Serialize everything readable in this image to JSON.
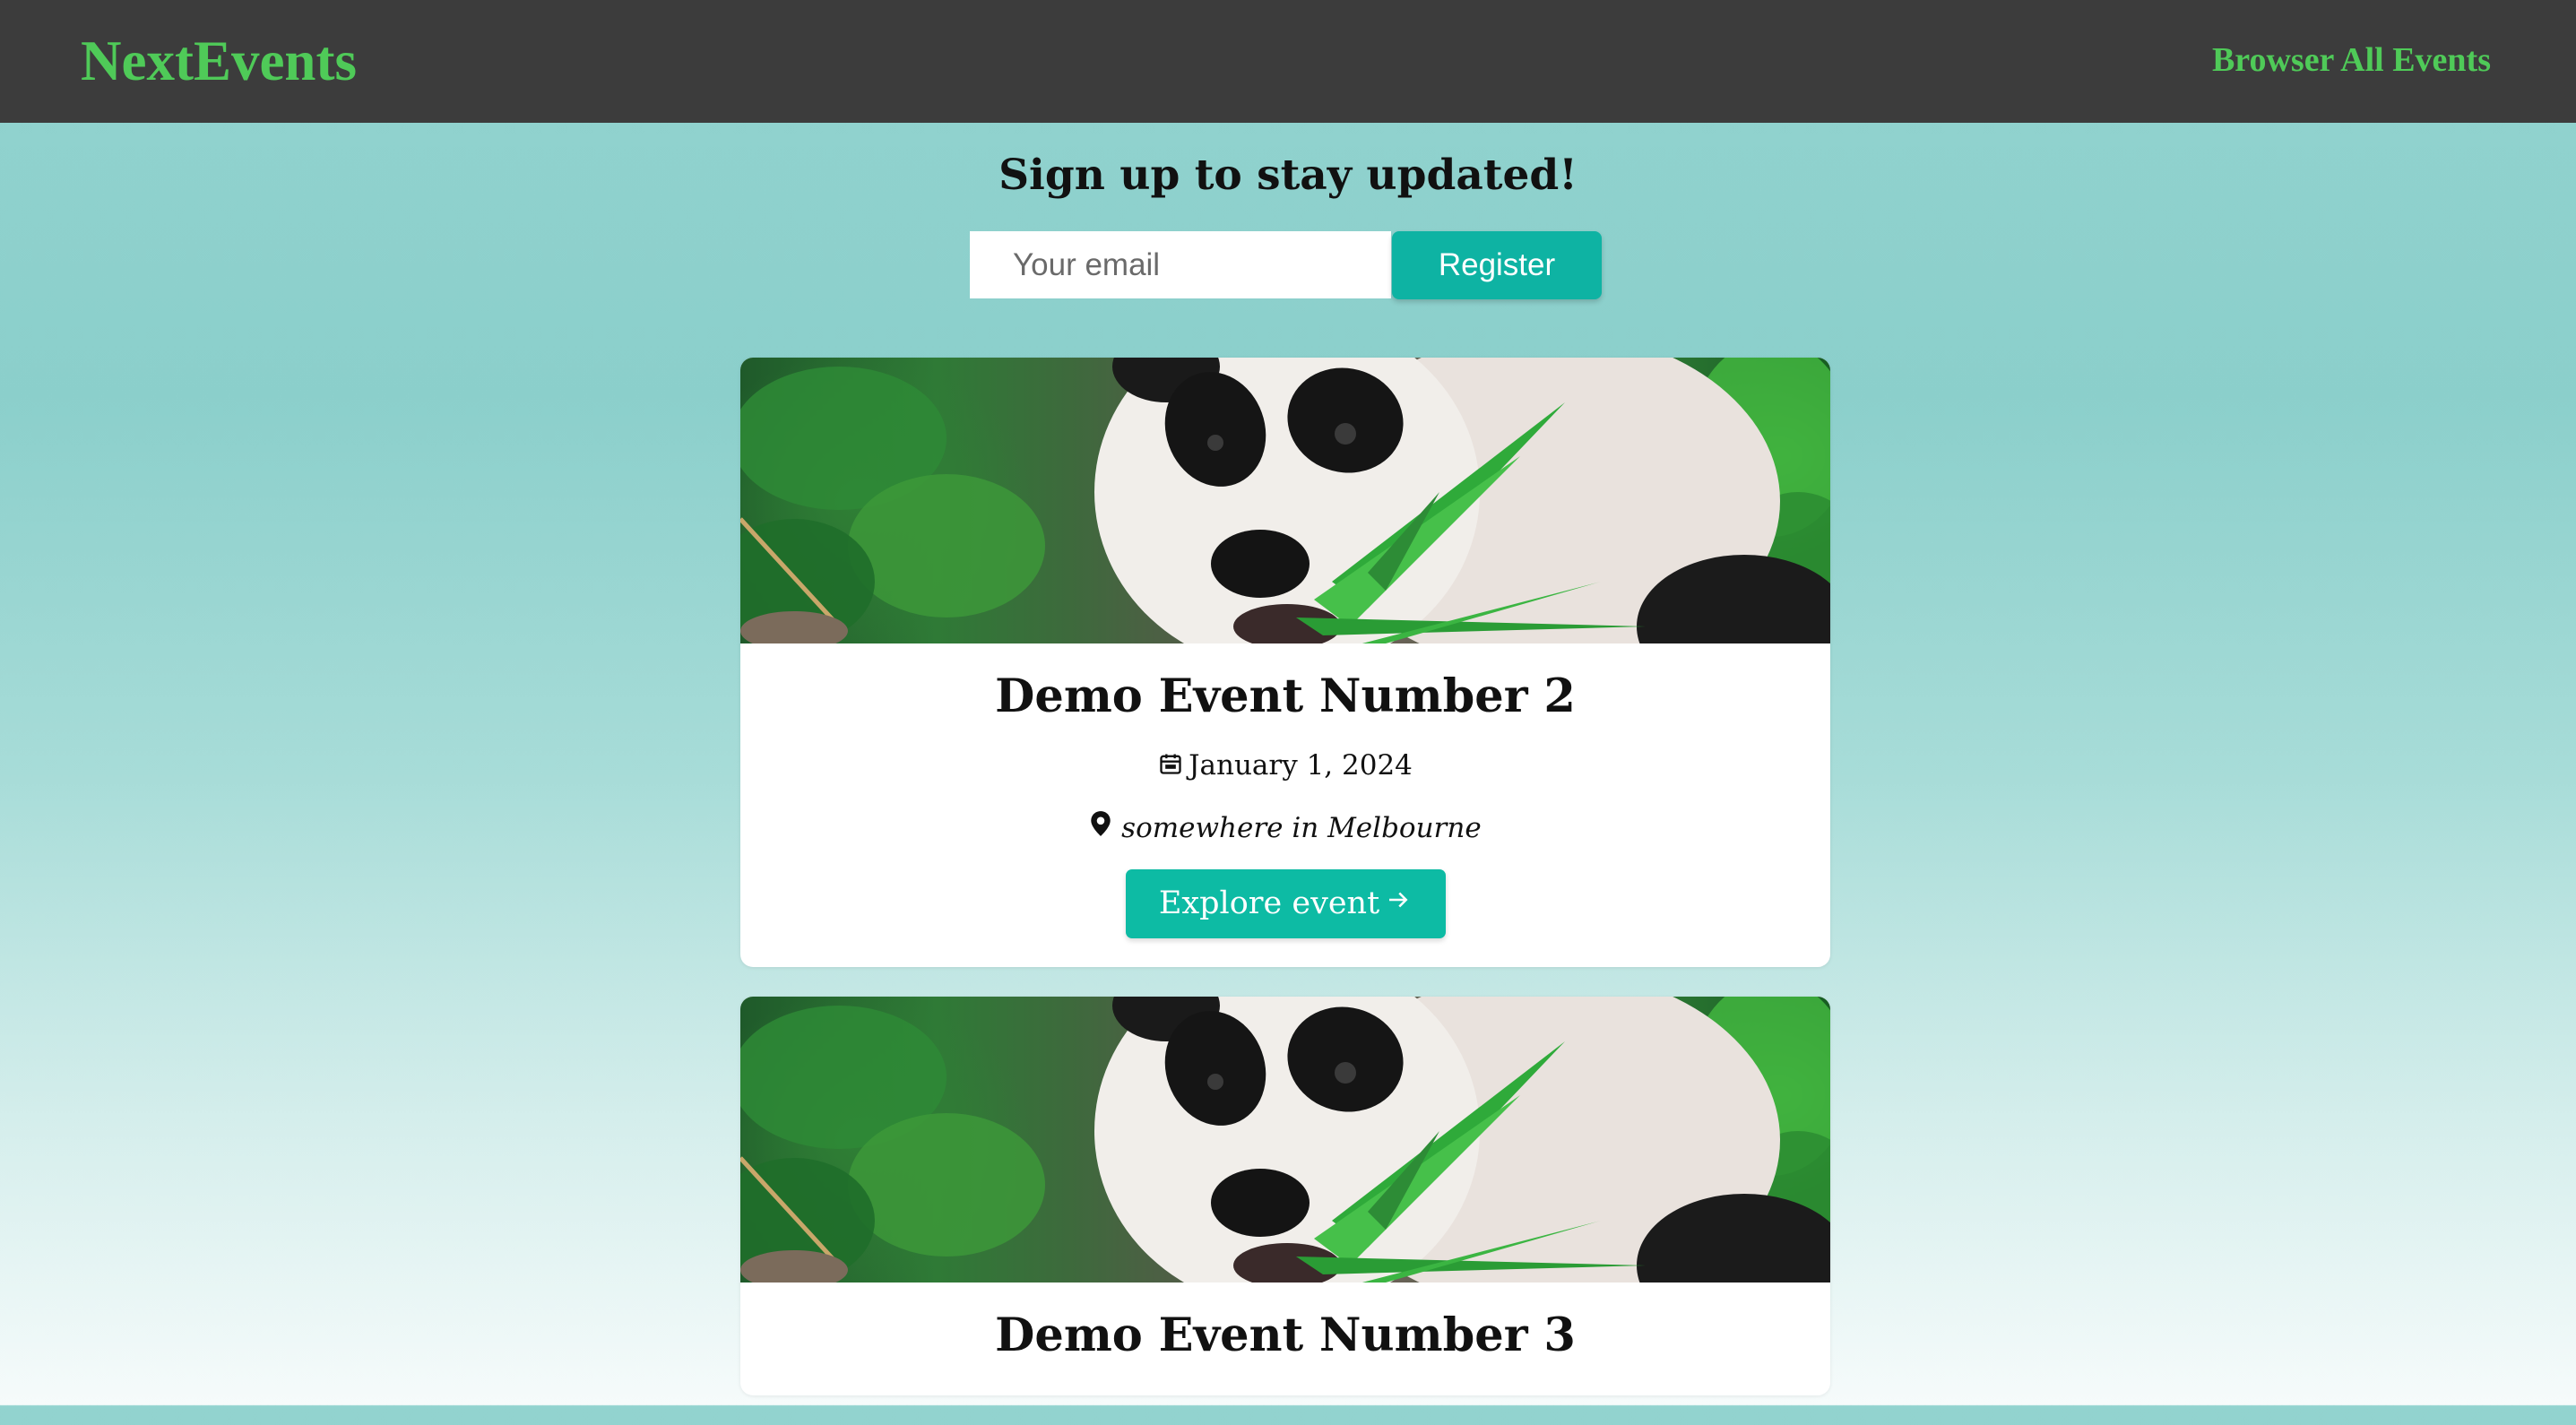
{
  "header": {
    "logo": "NextEvents",
    "nav_link": "Browser All Events"
  },
  "signup": {
    "title": "Sign up to stay updated!",
    "email_placeholder": "Your email",
    "register_label": "Register"
  },
  "events": [
    {
      "title": "Demo Event Number 2",
      "date": "January 1, 2024",
      "location": "somewhere in Melbourne",
      "button_label": "Explore event",
      "image": "panda-eating-bamboo"
    },
    {
      "title": "Demo Event Number 3",
      "image": "panda-eating-bamboo"
    }
  ],
  "icons": {
    "date": "calendar-icon",
    "location": "map-pin-icon",
    "button": "arrow-right-icon"
  },
  "colors": {
    "header_bg": "#3c3c3c",
    "brand_green": "#4fca58",
    "accent_teal": "#0eb3a3",
    "card_bg": "#ffffff"
  }
}
